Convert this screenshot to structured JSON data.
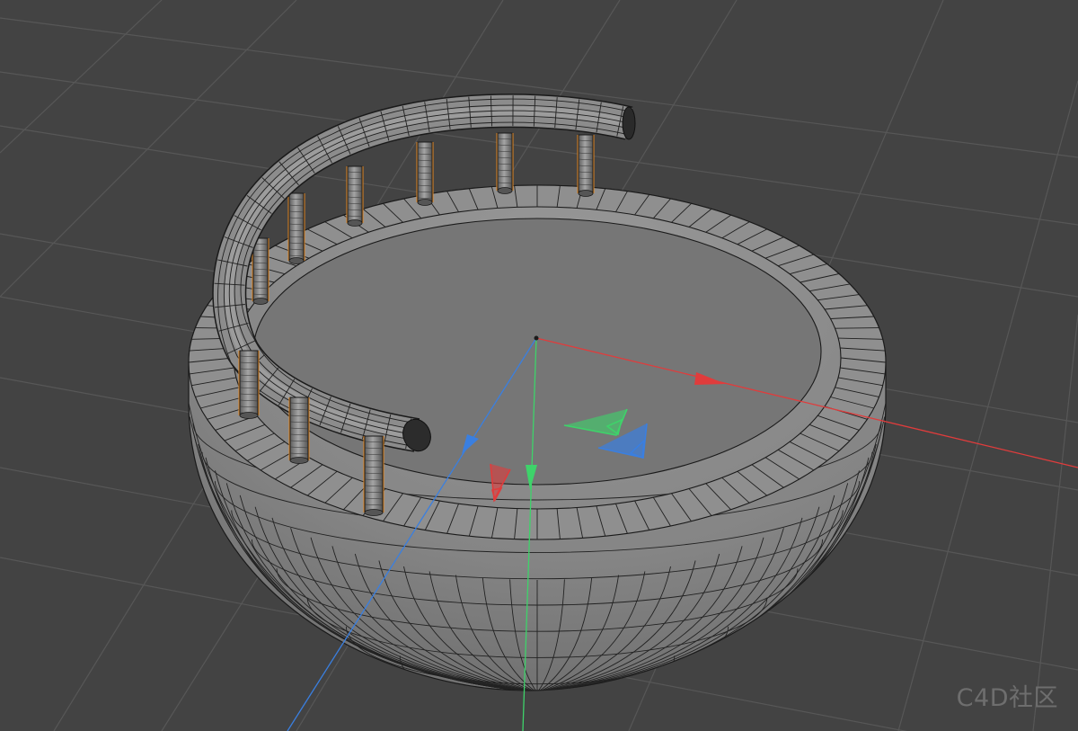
{
  "viewport": {
    "background_color": "#434343",
    "grid_color": "#575757",
    "object": "bowl-with-railing",
    "wireframe_color": "#1a1a1a",
    "surface_color": "#8a8a8a",
    "selection_highlight_color": "#e08a2a"
  },
  "axis_gizmo": {
    "x_color": "#e03c3c",
    "y_color": "#3ed36a",
    "z_color": "#3a7fe0"
  },
  "watermark": {
    "text": "C4D社区"
  }
}
